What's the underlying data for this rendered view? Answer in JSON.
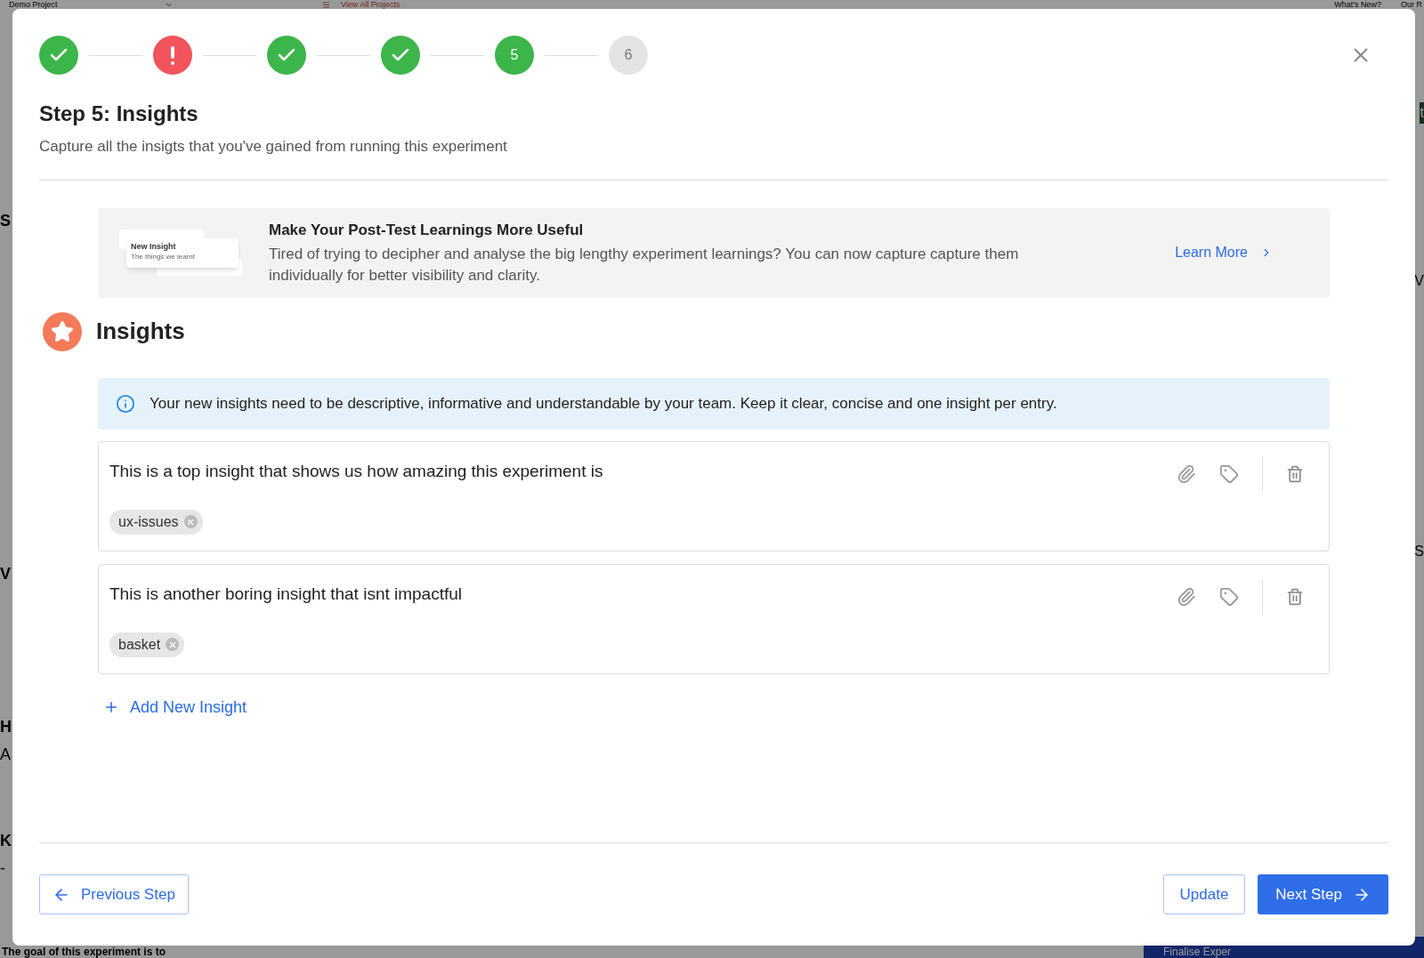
{
  "background": {
    "project_select": "Demo Project",
    "projects_link": "View All Projects",
    "nav_links": [
      "What's New?",
      "Our R"
    ],
    "left_letters": [
      "S",
      "V",
      "H",
      "A",
      "K",
      "-"
    ],
    "right_letters": [
      "t",
      "V",
      "S"
    ],
    "goal_text": "The goal of this experiment is to",
    "finalise_button": "Finalise Exper"
  },
  "steps": [
    {
      "kind": "done"
    },
    {
      "kind": "error"
    },
    {
      "kind": "done"
    },
    {
      "kind": "done"
    },
    {
      "kind": "current",
      "label": "5"
    },
    {
      "kind": "pending",
      "label": "6"
    }
  ],
  "title": "Step 5: Insights",
  "subtitle": "Capture all the insigts that you've gained from running this experiment",
  "banner": {
    "thumb_title": "New Insight",
    "thumb_subtitle": "The things we learnt",
    "heading": "Make Your Post-Test Learnings More Useful",
    "text": "Tired of trying to decipher and analyse the big lengthy experiment learnings? You can now capture capture them individually for better visibility and clarity.",
    "link": "Learn More"
  },
  "section_title": "Insights",
  "info": "Your new insights need to be descriptive, informative and understandable by your team. Keep it clear, concise and one insight per entry.",
  "insights": [
    {
      "text": "This is a top insight that shows us how amazing this experiment is",
      "tags": [
        "ux-issues"
      ]
    },
    {
      "text": "This is another boring insight that isnt impactful",
      "tags": [
        "basket"
      ]
    }
  ],
  "add_link": "Add New Insight",
  "buttons": {
    "previous": "Previous Step",
    "update": "Update",
    "next": "Next Step"
  }
}
